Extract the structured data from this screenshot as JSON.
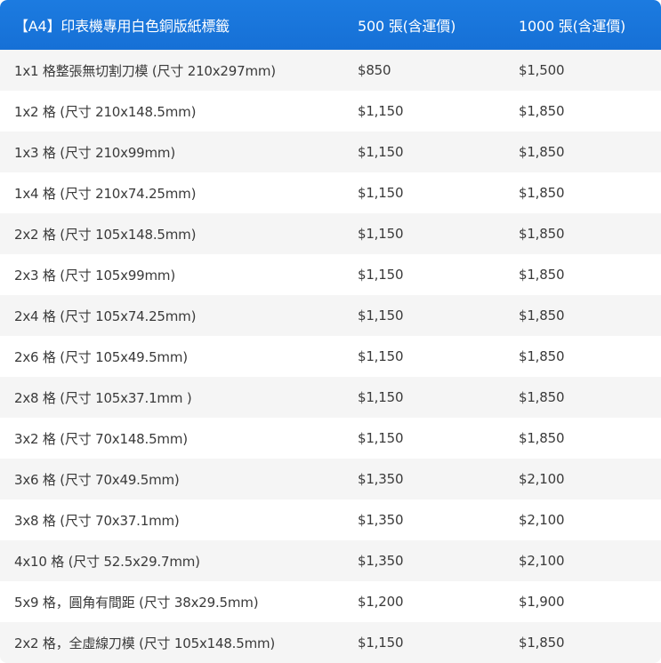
{
  "header": {
    "col_spec": "【A4】印表機專用白色銅版紙標籤",
    "col_500": "500 張(含運價)",
    "col_1000": "1000  張(含運價)"
  },
  "rows": [
    {
      "spec": "1x1   格整張無切割刀模 (尺寸 210x297mm)",
      "p500": "$850",
      "p1000": "$1,500"
    },
    {
      "spec": "1x2  格 (尺寸 210x148.5mm)",
      "p500": "$1,150",
      "p1000": "$1,850"
    },
    {
      "spec": "1x3  格 (尺寸 210x99mm)",
      "p500": "$1,150",
      "p1000": "$1,850"
    },
    {
      "spec": "1x4  格 (尺寸 210x74.25mm)",
      "p500": "$1,150",
      "p1000": "$1,850"
    },
    {
      "spec": "2x2 格 (尺寸 105x148.5mm)",
      "p500": "$1,150",
      "p1000": "$1,850"
    },
    {
      "spec": "2x3 格 (尺寸 105x99mm)",
      "p500": "$1,150",
      "p1000": "$1,850"
    },
    {
      "spec": "2x4 格 (尺寸 105x74.25mm)",
      "p500": "$1,150",
      "p1000": "$1,850"
    },
    {
      "spec": "2x6 格 (尺寸 105x49.5mm)",
      "p500": "$1,150",
      "p1000": "$1,850"
    },
    {
      "spec": "2x8 格 (尺寸 105x37.1mm )",
      "p500": "$1,150",
      "p1000": "$1,850"
    },
    {
      "spec": "3x2 格 (尺寸 70x148.5mm)",
      "p500": "$1,150",
      "p1000": "$1,850"
    },
    {
      "spec": "3x6 格 (尺寸 70x49.5mm)",
      "p500": "$1,350",
      "p1000": "$2,100"
    },
    {
      "spec": "3x8 格 (尺寸 70x37.1mm)",
      "p500": "$1,350",
      "p1000": "$2,100"
    },
    {
      "spec": "4x10  格 (尺寸 52.5x29.7mm)",
      "p500": "$1,350",
      "p1000": "$2,100"
    },
    {
      "spec": "5x9 格，圓角有間距 (尺寸 38x29.5mm)",
      "p500": "$1,200",
      "p1000": "$1,900"
    },
    {
      "spec": "2x2 格，全虛線刀模 (尺寸 105x148.5mm)",
      "p500": "$1,150",
      "p1000": "$1,850"
    }
  ]
}
